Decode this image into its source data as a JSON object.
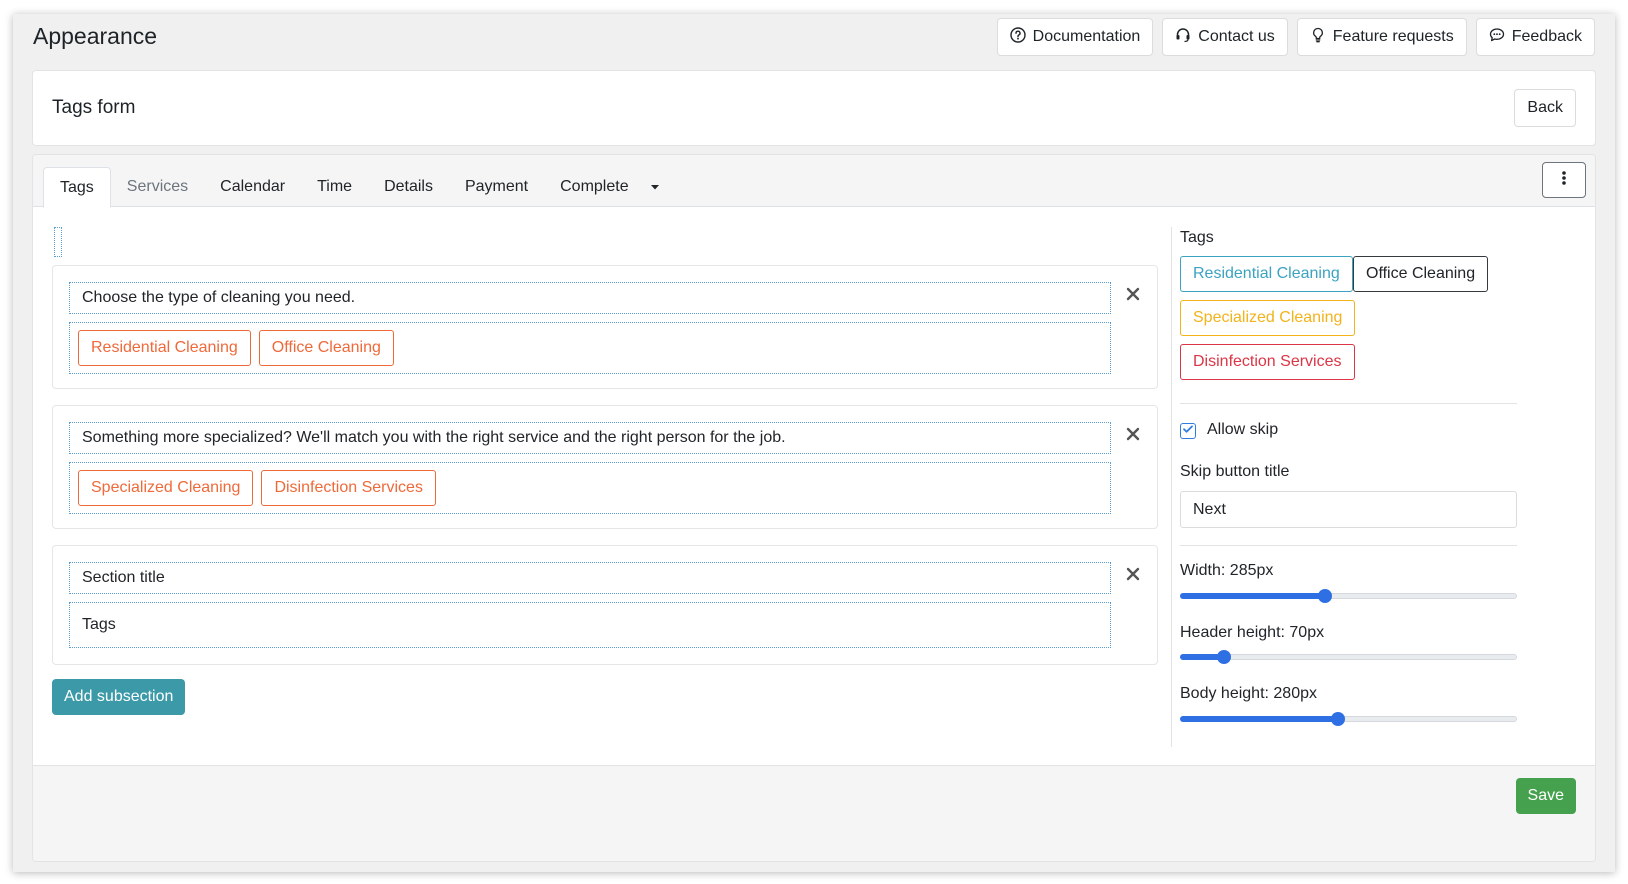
{
  "page": {
    "title": "Appearance"
  },
  "top_actions": [
    {
      "label": "Documentation",
      "icon": "question-circle-icon"
    },
    {
      "label": "Contact us",
      "icon": "headset-icon"
    },
    {
      "label": "Feature requests",
      "icon": "lightbulb-icon"
    },
    {
      "label": "Feedback",
      "icon": "chat-icon"
    }
  ],
  "header": {
    "form_title": "Tags form",
    "back_label": "Back"
  },
  "tabs": [
    "Tags",
    "Services",
    "Calendar",
    "Time",
    "Details",
    "Payment",
    "Complete"
  ],
  "active_tab": "Tags",
  "subsections": [
    {
      "title": "Choose the type of cleaning you need.",
      "tags": [
        "Residential Cleaning",
        "Office Cleaning"
      ]
    },
    {
      "title": "Something more specialized? We'll match you with the right service and the right person for the job.",
      "tags": [
        "Specialized Cleaning",
        "Disinfection Services"
      ]
    },
    {
      "title": "Section title",
      "placeholder": "Tags"
    }
  ],
  "add_subsection_label": "Add subsection",
  "sidebar": {
    "tags_label": "Tags",
    "tags": [
      {
        "label": "Residential Cleaning",
        "color": "#3ba3c1"
      },
      {
        "label": "Office Cleaning",
        "color": "#343a40"
      },
      {
        "label": "Specialized Cleaning",
        "color": "#f2b31b"
      },
      {
        "label": "Disinfection Services",
        "color": "#dc3545"
      }
    ],
    "allow_skip": {
      "label": "Allow skip",
      "checked": true
    },
    "skip_button_title_label": "Skip button title",
    "skip_button_title_value": "Next",
    "width": {
      "label": "Width: 285px",
      "value": 285,
      "level": 0.43
    },
    "header_height": {
      "label": "Header height: 70px",
      "value": 70,
      "level": 0.13
    },
    "body_height": {
      "label": "Body height: 280px",
      "value": 280,
      "level": 0.47
    }
  },
  "save_label": "Save",
  "colors": {
    "accent": "#2f6fe4",
    "tag_orange": "#ee6a3b",
    "add_button": "#3c9aa8",
    "save_button": "#46a14e",
    "dotted_border": "#5a9fd4"
  }
}
